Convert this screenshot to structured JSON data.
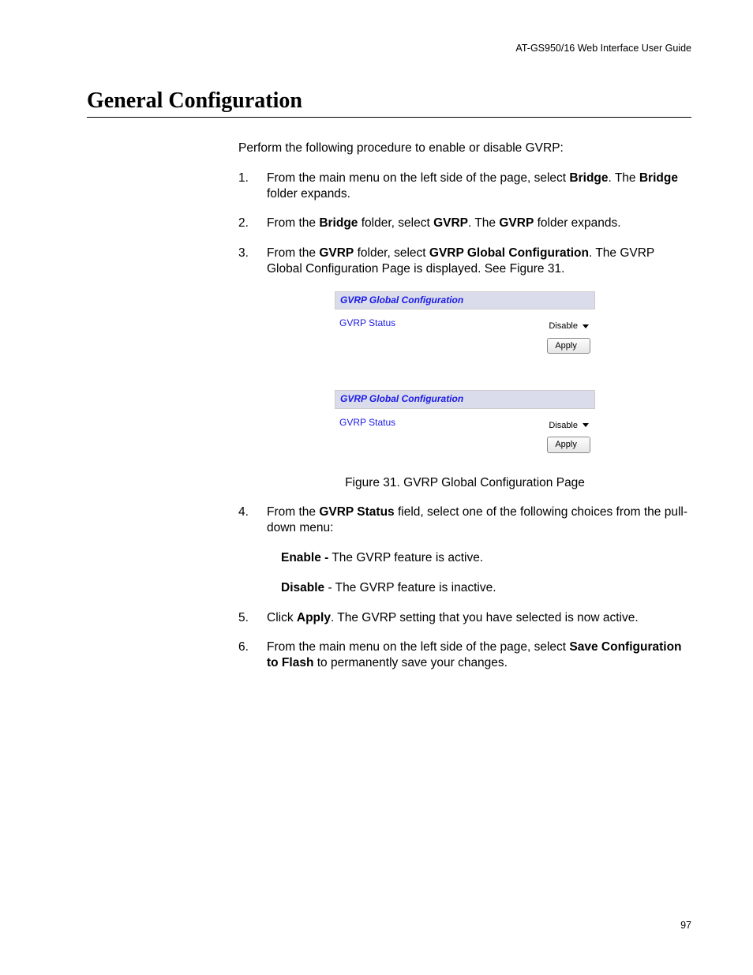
{
  "header": {
    "guide": "AT-GS950/16  Web Interface User Guide"
  },
  "title": "General Configuration",
  "intro": "Perform the following procedure to enable or disable GVRP:",
  "steps": {
    "s1": {
      "num": "1.",
      "pre": "From the main menu on the left side of the page, select ",
      "b1": "Bridge",
      "post1": ". The ",
      "b2": "Bridge",
      "post2": " folder expands."
    },
    "s2": {
      "num": "2.",
      "pre": "From the ",
      "b1": "Bridge",
      "mid": " folder, select ",
      "b2": "GVRP",
      "post1": ". The ",
      "b3": "GVRP",
      "post2": " folder expands."
    },
    "s3": {
      "num": "3.",
      "pre": "From the ",
      "b1": "GVRP",
      "mid": " folder, select ",
      "b2": "GVRP Global Configuration",
      "post": ". The GVRP Global Configuration Page is displayed. See Figure 31."
    },
    "s4": {
      "num": "4.",
      "pre": "From the ",
      "b1": "GVRP Status",
      "post": " field, select one of the following choices from the pull-down menu:"
    },
    "s5": {
      "num": "5.",
      "pre": "Click ",
      "b1": "Apply",
      "post": ". The GVRP setting that you have selected is now active."
    },
    "s6": {
      "num": "6.",
      "pre": "From the main menu on the left side of the page, select ",
      "b1": "Save Configuration to Flash",
      "post": " to permanently save your changes."
    }
  },
  "options": {
    "enable_b": "Enable -",
    "enable_t": " The GVRP feature is active.",
    "disable_b": "Disable",
    "disable_t": " - The GVRP feature is inactive."
  },
  "panel": {
    "title": "GVRP Global Configuration",
    "label": "GVRP Status",
    "select": "Disable",
    "button": "Apply"
  },
  "figure_caption": "Figure 31. GVRP Global Configuration Page",
  "page_number": "97"
}
